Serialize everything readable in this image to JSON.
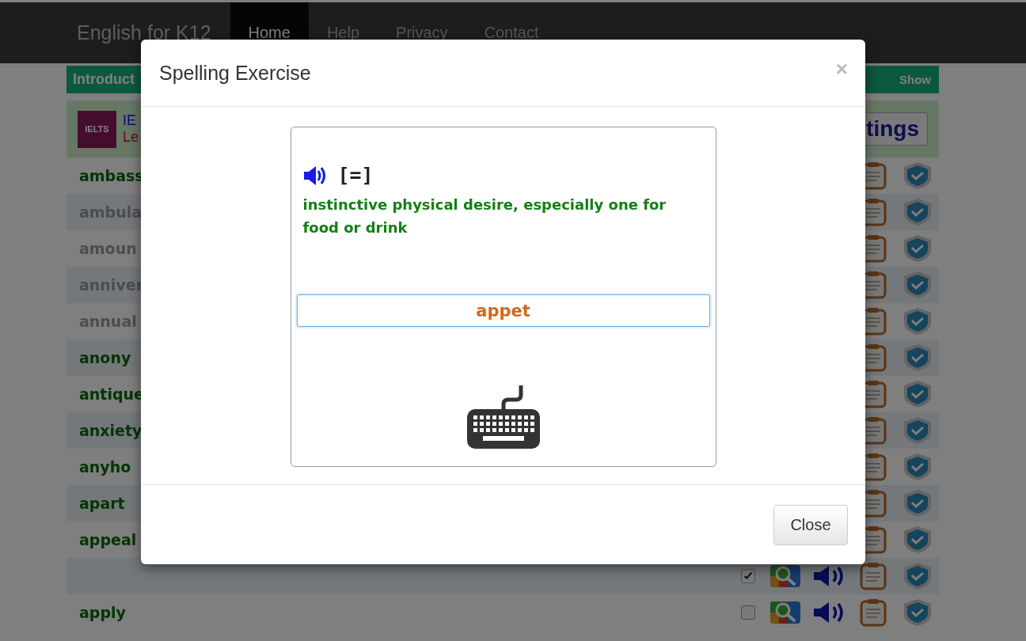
{
  "navbar": {
    "brand": "English for K12",
    "items": [
      {
        "label": "Home",
        "selected": true
      },
      {
        "label": "Help",
        "selected": false
      },
      {
        "label": "Privacy",
        "selected": false
      },
      {
        "label": "Contact",
        "selected": false
      }
    ]
  },
  "intro_bar": {
    "title": "Introduct",
    "toggle": "Show"
  },
  "banner": {
    "logo_text": "IELTS",
    "title": "IE",
    "subtitle": "Le",
    "button": "tings"
  },
  "words": [
    {
      "word": "ambass",
      "muted": false
    },
    {
      "word": "ambula",
      "muted": true
    },
    {
      "word": "amoun",
      "muted": true
    },
    {
      "word": "anniver",
      "muted": true
    },
    {
      "word": "annual",
      "muted": true
    },
    {
      "word": "anony",
      "muted": false
    },
    {
      "word": "antique",
      "muted": false
    },
    {
      "word": "anxiety",
      "muted": false
    },
    {
      "word": "anyho",
      "muted": false
    },
    {
      "word": "apart",
      "muted": false
    },
    {
      "word": "appeal",
      "muted": false
    },
    {
      "checked": true
    },
    {
      "word": "apply",
      "muted": false,
      "checked": false
    }
  ],
  "modal": {
    "title": "Spelling Exercise",
    "close_symbol": "×",
    "phonetic": "[=]",
    "definition": "instinctive physical desire, especially one for food or drink",
    "answer": "appet",
    "close_button": "Close"
  }
}
